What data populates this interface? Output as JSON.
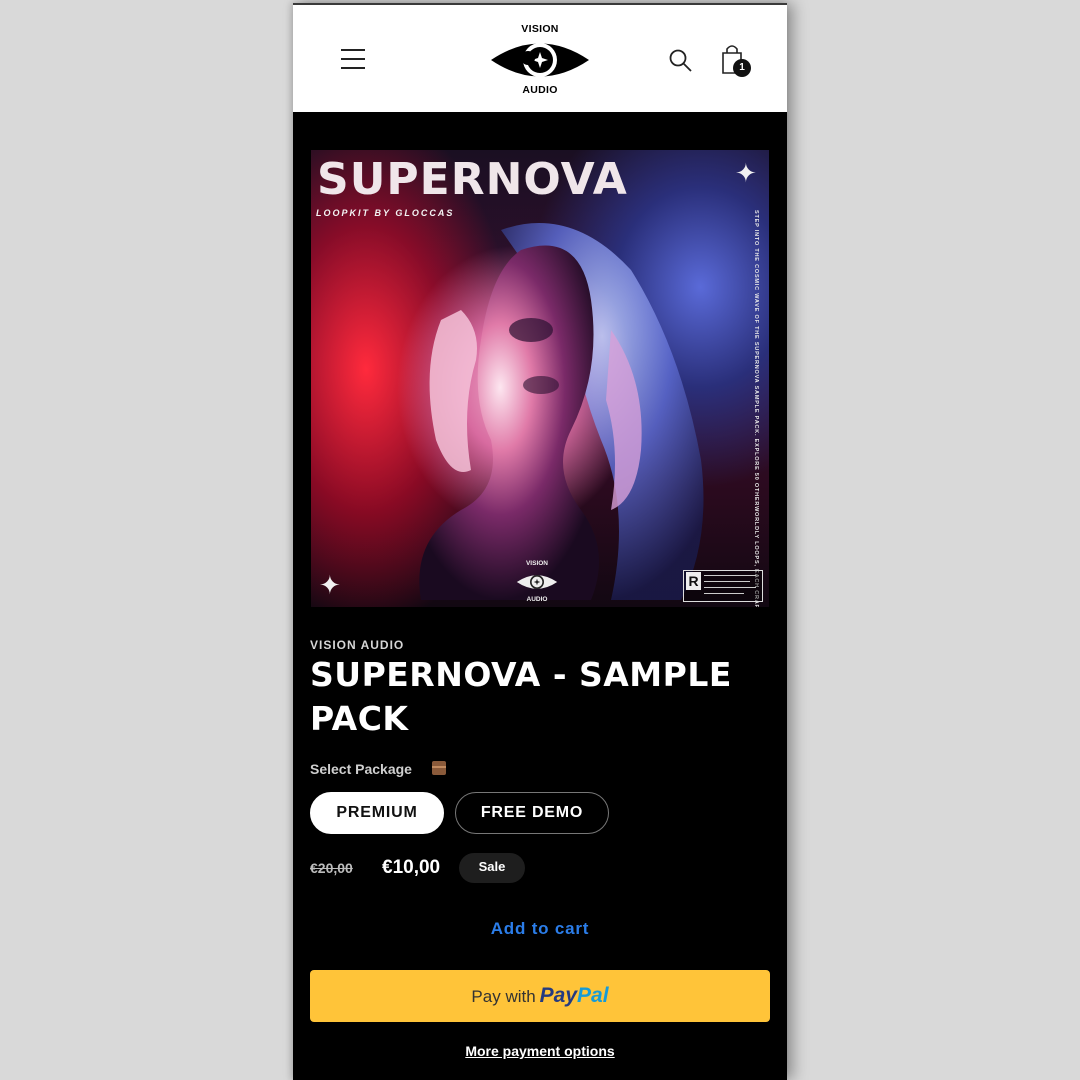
{
  "header": {
    "logo_top": "VISION",
    "logo_bottom": "AUDIO",
    "cart_count": "1",
    "icons": [
      "hamburger-menu-icon",
      "eye-logo",
      "search-icon",
      "shopping-bag-icon"
    ]
  },
  "cover": {
    "title": "SUPERNOVA",
    "subtitle": "LOOPKIT BY GLOCCAS",
    "side_text": "STEP INTO THE COSMIC WAVE OF THE SUPERNOVA SAMPLE PACK. EXPLORE 50 OTHERWORLDLY LOOPS, EACH CRAFTED TO IGNITE YOUR CREATIVE JOURNEY. WELCOME TO THE UNIVERSE OF SUPERNOVA.",
    "logo_top": "VISION",
    "logo_bottom": "AUDIO",
    "rating_letter": "R"
  },
  "product": {
    "brand": "VISION AUDIO",
    "title": "SUPERNOVA - SAMPLE PACK",
    "select_label": "Select Package",
    "packages": [
      "PREMIUM",
      "FREE DEMO"
    ],
    "selected_package": "PREMIUM",
    "old_price": "€20,00",
    "price": "€10,00",
    "badge": "Sale"
  },
  "actions": {
    "add_to_cart": "Add to cart",
    "paypal_with": "Pay with",
    "paypal_pay": "Pay",
    "paypal_pal": "Pal",
    "more_options": "More payment options"
  },
  "colors": {
    "accent_link": "#2b7de9",
    "paypal_yellow": "#ffc439",
    "background": "#000000"
  }
}
